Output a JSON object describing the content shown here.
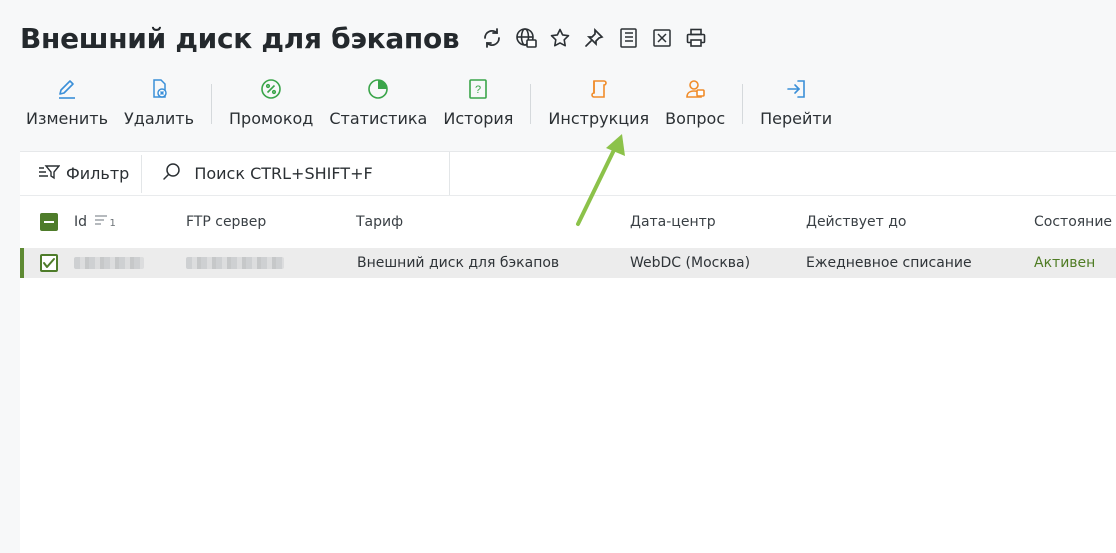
{
  "page": {
    "title": "Внешний диск для бэкапов"
  },
  "title_actions": [
    {
      "name": "refresh-icon"
    },
    {
      "name": "globe-icon"
    },
    {
      "name": "star-icon"
    },
    {
      "name": "pin-icon"
    },
    {
      "name": "document-list-icon"
    },
    {
      "name": "excel-export-icon"
    },
    {
      "name": "print-icon"
    }
  ],
  "toolbar": {
    "edit_label": "Изменить",
    "delete_label": "Удалить",
    "promo_label": "Промокод",
    "stats_label": "Статистика",
    "history_label": "История",
    "instruction_label": "Инструкция",
    "question_label": "Вопрос",
    "goto_label": "Перейти"
  },
  "filter": {
    "label": "Фильтр"
  },
  "search": {
    "label": "Поиск CTRL+SHIFT+F"
  },
  "table": {
    "columns": {
      "id": "Id",
      "sort_index": "1",
      "ftp": "FTP сервер",
      "tariff": "Тариф",
      "datacenter": "Дата-центр",
      "valid_until": "Действует до",
      "state": "Состояние"
    },
    "rows": [
      {
        "tariff": "Внешний диск для бэкапов",
        "datacenter": "WebDC (Москва)",
        "valid_until": "Ежедневное списание",
        "state": "Активен"
      }
    ]
  },
  "colors": {
    "accent_green": "#4e7c2a",
    "blue": "#3a8fd8",
    "green": "#3aa54a",
    "orange": "#f08c2a",
    "arrow": "#8cc24a"
  }
}
